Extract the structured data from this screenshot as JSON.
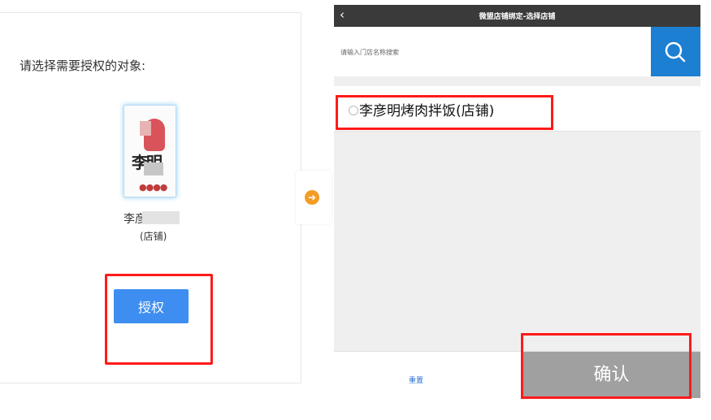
{
  "left_panel": {
    "prompt": "请选择需要授权的对象:",
    "store": {
      "logo_text": "李明",
      "logo_dots": "●●●●",
      "name": "李彦",
      "tag": "(店铺)"
    },
    "authorize_button": "授权"
  },
  "arrow_icon": "arrow-right-circle",
  "phone": {
    "title": "微盟店铺绑定-选择店铺",
    "back_icon": "‹",
    "search_placeholder": "请输入门店名称搜索",
    "search_icon": "search-icon",
    "result_store": "李彦明烤肉拌饭(店铺)",
    "reset_label": "重置",
    "confirm_label": "确认"
  },
  "colors": {
    "primary_blue": "#3d8ef0",
    "search_blue": "#1c7fd1",
    "highlight_red": "#ff1a1a",
    "arrow_orange": "#f39c26",
    "confirm_gray": "#a0a0a0"
  }
}
